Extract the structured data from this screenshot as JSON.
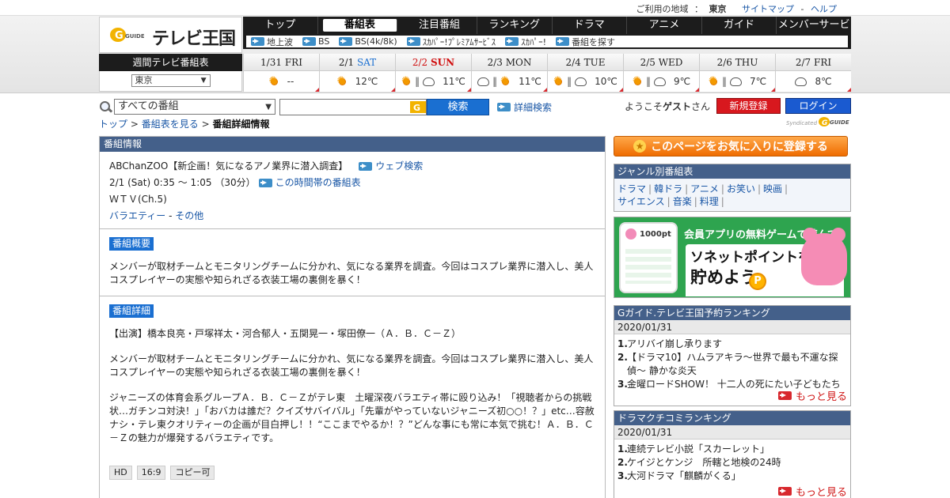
{
  "top_strip": {
    "region_label": "ご利用の地域",
    "region_sep": "：",
    "region_value": "東京",
    "sitemap": "サイトマップ",
    "dash": "-",
    "help": "ヘルプ"
  },
  "logo": {
    "g_text": "GUIDE",
    "name": "テレビ王国"
  },
  "gnav": [
    "トップ",
    "番組表",
    "注目番組",
    "ランキング",
    "ドラマ",
    "アニメ",
    "ガイド",
    "メンバーサービス"
  ],
  "subnav": [
    "地上波",
    "BS",
    "BS(4k/8k)",
    "ｽｶﾊﾟｰ!ﾌﾟﾚﾐｱﾑｻｰﾋﾞｽ",
    "ｽｶﾊﾟｰ!",
    "番組を探す"
  ],
  "weekly": {
    "label": "週間テレビ番組表",
    "area": "東京",
    "days": [
      {
        "date": "1/31",
        "dow": "FRI",
        "w1": "sun",
        "w2": "",
        "temp": "--"
      },
      {
        "date": "2/1",
        "dow": "SAT",
        "w1": "sun",
        "w2": "",
        "temp": "12℃"
      },
      {
        "date": "2/2",
        "dow": "SUN",
        "w1": "sun",
        "w2": "cloud",
        "temp": "11℃"
      },
      {
        "date": "2/3",
        "dow": "MON",
        "w1": "cloud",
        "w2": "sun",
        "temp": "11℃"
      },
      {
        "date": "2/4",
        "dow": "TUE",
        "w1": "sun",
        "w2": "cloud",
        "temp": "10℃"
      },
      {
        "date": "2/5",
        "dow": "WED",
        "w1": "sun",
        "w2": "cloud",
        "temp": "9℃"
      },
      {
        "date": "2/6",
        "dow": "THU",
        "w1": "sun",
        "w2": "cloud",
        "temp": "7℃"
      },
      {
        "date": "2/7",
        "dow": "FRI",
        "w1": "cloud",
        "w2": "",
        "temp": "8℃"
      }
    ]
  },
  "search": {
    "scope": "すべての番組",
    "button": "検索",
    "advanced": "詳細検索"
  },
  "account": {
    "welcome_prefix": "ようこそ",
    "guest": "ゲスト",
    "welcome_suffix": "さん",
    "register": "新規登録",
    "login": "ログイン",
    "syndicated": "Syndicated",
    "g_text": "GUIDE"
  },
  "breadcrumb": {
    "top": "トップ",
    "gt1": ">",
    "schedule": "番組表を見る",
    "gt2": ">",
    "current": "番組詳細情報"
  },
  "program": {
    "panel_title": "番組情報",
    "title": "ABChanZOO【新企画！気になるアノ業界に潜入調査】",
    "web_search": "ウェブ検索",
    "time": "2/1 (Sat) 0:35 ～ 1:05 （30分）",
    "time_link": "この時間帯の番組表",
    "channel": "ＷＴＶ(Ch.5)",
    "genre1": "バラエティー",
    "genre_sep": "-",
    "genre2": "その他",
    "summary_tag": "番組概要",
    "summary": "メンバーが取材チームとモニタリングチームに分かれ、気になる業界を調査。今回はコスプレ業界に潜入し、美人コスプレイヤーの実態や知られざる衣装工場の裏側を暴く！",
    "detail_tag": "番組詳細",
    "cast": "【出演】橋本良亮・戸塚祥太・河合郁人・五関晃一・塚田僚一（Ａ．Ｂ．Ｃ－Ｚ）",
    "detail1": "メンバーが取材チームとモニタリングチームに分かれ、気になる業界を調査。今回はコスプレ業界に潜入し、美人コスプレイヤーの実態や知られざる衣装工場の裏側を暴く！",
    "detail2": "ジャニーズの体育会系グループＡ．Ｂ．Ｃ－Ｚがテレ東　土曜深夜バラエティ帯に殴り込み！「視聴者からの挑戦状…ガチンコ対決！」「おバカは誰だ？クイズサバイバル」「先輩がやっていないジャニーズ初○○！？」etc…容赦ナシ・テレ東クオリティーの企画が目白押し！！“ここまでやるか！？”どんな事にも常に本気で挑む！Ａ．Ｂ．Ｃ－Ｚの魅力が爆発するバラエティです。",
    "chips": [
      "HD",
      "16:9",
      "コピー可"
    ]
  },
  "sidebar": {
    "favorite": "このページをお気に入りに登録する",
    "genre_title": "ジャンル別番組表",
    "genres": [
      "ドラマ",
      "韓ドラ",
      "アニメ",
      "お笑い",
      "映画",
      "サイエンス",
      "音楽",
      "料理"
    ],
    "genre_sep": "|",
    "ad": {
      "phone_pt": "1000pt",
      "line1": "会員アプリの無料ゲームで遊んで",
      "line2": "ソネットポイントを",
      "line3": "貯めよう",
      "coin": "P"
    },
    "rank1": {
      "title": "Gガイド.テレビ王国予約ランキング",
      "date": "2020/01/31",
      "items": [
        {
          "n": "1.",
          "t": "アリバイ崩し承ります"
        },
        {
          "n": "2.",
          "t": "【ドラマ10】ハムラアキラ〜世界で最も不運な探偵〜 静かな炎天"
        },
        {
          "n": "3.",
          "t": "金曜ロードSHOW！ 十二人の死にたい子どもたち"
        }
      ],
      "more": "もっと見る"
    },
    "rank2": {
      "title": "ドラマクチコミランキング",
      "date": "2020/01/31",
      "items": [
        {
          "n": "1.",
          "t": "連続テレビ小説「スカーレット」"
        },
        {
          "n": "2.",
          "t": "ケイジとケンジ　所轄と地検の24時"
        },
        {
          "n": "3.",
          "t": "大河ドラマ「麒麟がくる」"
        }
      ],
      "more": "もっと見る"
    }
  },
  "colors": {
    "nav_bg": "#1c1c1c",
    "panel_header": "#44608a",
    "link": "#1a57a6",
    "register": "#d8181e",
    "login": "#1a5ad0",
    "favorite": "#ef6c00"
  }
}
